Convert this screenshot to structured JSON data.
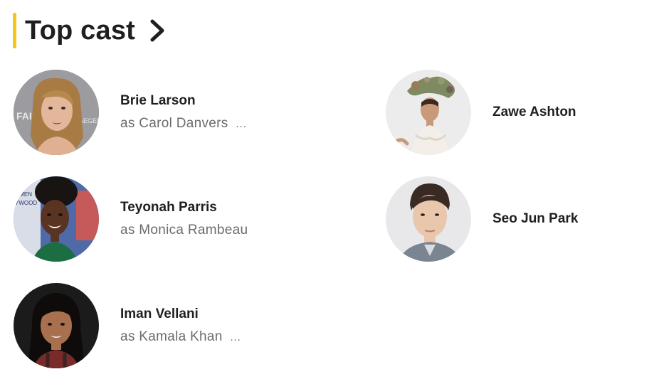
{
  "section": {
    "title": "Top cast",
    "accent_color": "#f5c518",
    "chevron_icon": "chevron-right-icon"
  },
  "cast": [
    {
      "name": "Brie Larson",
      "role": "as Carol Danvers",
      "more": "…",
      "avatar_icon": "person-photo-avatar"
    },
    {
      "name": "Zawe Ashton",
      "role": "",
      "more": "",
      "avatar_icon": "person-photo-avatar"
    },
    {
      "name": "Teyonah Parris",
      "role": "as Monica Rambeau",
      "more": "",
      "avatar_icon": "person-photo-avatar"
    },
    {
      "name": "Seo Jun Park",
      "role": "",
      "more": "",
      "avatar_icon": "person-photo-avatar"
    },
    {
      "name": "Iman Vellani",
      "role": "as Kamala Khan",
      "more": "…",
      "avatar_icon": "person-photo-avatar"
    }
  ]
}
